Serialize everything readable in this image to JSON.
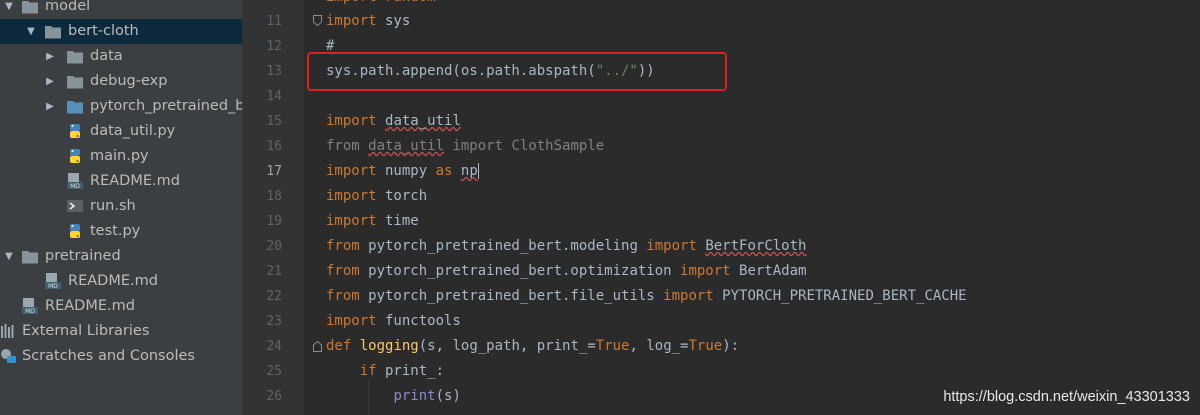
{
  "project_tree": {
    "items": [
      {
        "label": "model",
        "icon": "folder-icon"
      },
      {
        "label": "bert-cloth",
        "icon": "folder-icon"
      },
      {
        "label": "data",
        "icon": "folder-icon"
      },
      {
        "label": "debug-exp",
        "icon": "folder-icon"
      },
      {
        "label": "pytorch_pretrained_b",
        "icon": "folder-icon"
      },
      {
        "label": "data_util.py",
        "icon": "python-file-icon"
      },
      {
        "label": "main.py",
        "icon": "python-file-icon"
      },
      {
        "label": "README.md",
        "icon": "markdown-file-icon"
      },
      {
        "label": "run.sh",
        "icon": "shell-script-icon"
      },
      {
        "label": "test.py",
        "icon": "python-file-icon"
      },
      {
        "label": "pretrained",
        "icon": "folder-icon"
      },
      {
        "label": "README.md",
        "icon": "markdown-file-icon"
      },
      {
        "label": "README.md",
        "icon": "markdown-file-icon"
      },
      {
        "label": "External Libraries",
        "icon": "libraries-icon"
      },
      {
        "label": "Scratches and Consoles",
        "icon": "scratches-icon"
      }
    ],
    "selected": "bert-cloth"
  },
  "editor": {
    "line_numbers": [
      "11",
      "12",
      "13",
      "14",
      "15",
      "16",
      "17",
      "18",
      "19",
      "20",
      "21",
      "22",
      "23",
      "24",
      "25",
      "26"
    ],
    "current_line": "17",
    "partial_top_line": "import random",
    "code_lines": [
      "import sys",
      "#",
      "sys.path.append(os.path.abspath(\"../\"))",
      "",
      "import data_util",
      "from data_util import ClothSample",
      "import numpy as np",
      "import torch",
      "import time",
      "from pytorch_pretrained_bert.modeling import BertForCloth",
      "from pytorch_pretrained_bert.optimization import BertAdam",
      "from pytorch_pretrained_bert.file_utils import PYTORCH_PRETRAINED_BERT_CACHE",
      "import functools",
      "def logging(s, log_path, print_=True, log_=True):",
      "    if print_:",
      "        print(s)"
    ],
    "highlighted_line": "13",
    "highlight_color": "#e02020"
  },
  "colors": {
    "editor_bg": "#2b2b2b",
    "gutter_bg": "#313335",
    "sidebar_bg": "#3c3f41",
    "selection_bg": "#0d293e",
    "keyword": "#cc7832",
    "string": "#6a8759",
    "function": "#ffc66d"
  },
  "watermark": "https://blog.csdn.net/weixin_43301333"
}
